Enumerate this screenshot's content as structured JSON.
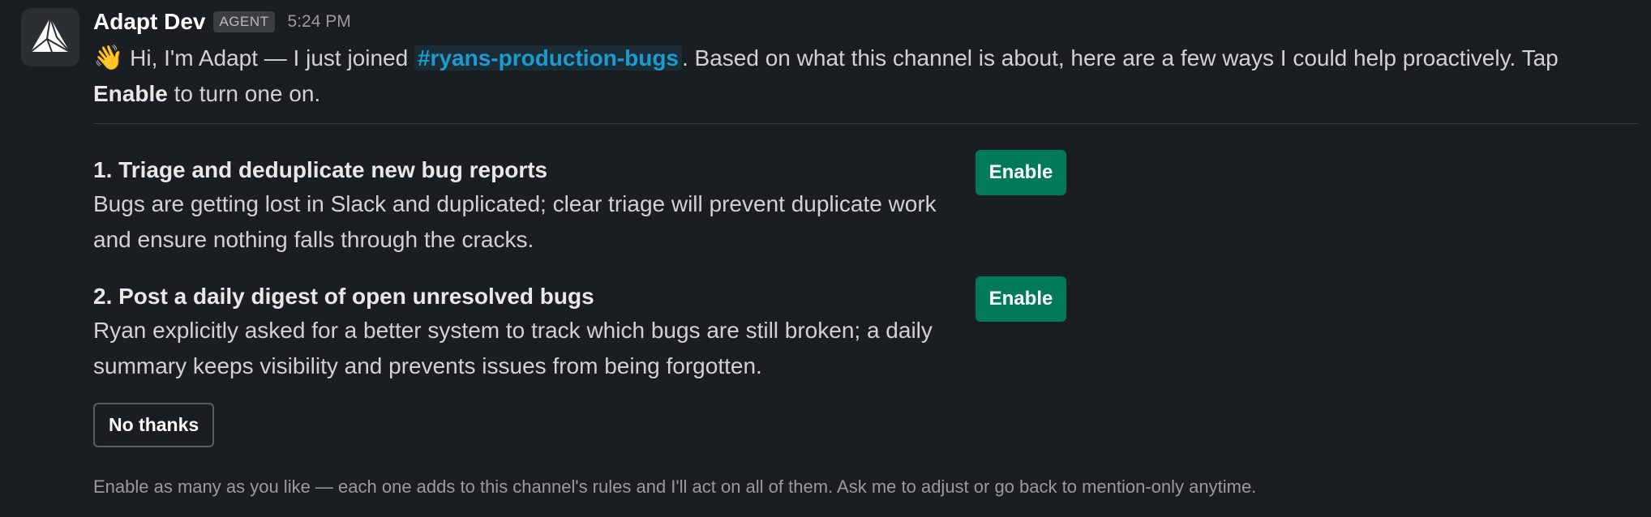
{
  "message": {
    "sender": "Adapt Dev",
    "badge": "AGENT",
    "timestamp": "5:24 PM",
    "intro": {
      "wave_emoji": "👋",
      "text_before_channel": " Hi, I'm Adapt — I just joined ",
      "channel": "#ryans-production-bugs",
      "text_after_channel": ". Based on what this channel is about, here are a few ways I could help proactively. Tap ",
      "strong_word": "Enable",
      "text_end": " to turn one on."
    },
    "options": [
      {
        "title": "1. Triage and deduplicate new bug reports",
        "description": "Bugs are getting lost in Slack and duplicated; clear triage will prevent duplicate work and ensure nothing falls through the cracks.",
        "button_label": "Enable"
      },
      {
        "title": "2. Post a daily digest of open unresolved bugs",
        "description": "Ryan explicitly asked for a better system to track which bugs are still broken; a daily summary keeps visibility and prevents issues from being forgotten.",
        "button_label": "Enable"
      }
    ],
    "no_thanks_label": "No thanks",
    "footer_note": "Enable as many as you like — each one adds to this channel's rules and I'll act on all of them. Ask me to adjust or go back to mention-only anytime."
  },
  "icons": {
    "avatar": "adapt-logo-icon",
    "wave": "waving-hand-icon"
  },
  "colors": {
    "background": "#1a1d21",
    "channel_link": "#1d9bd1",
    "enable_button": "#007a5a",
    "text": "#d1d2d3"
  }
}
